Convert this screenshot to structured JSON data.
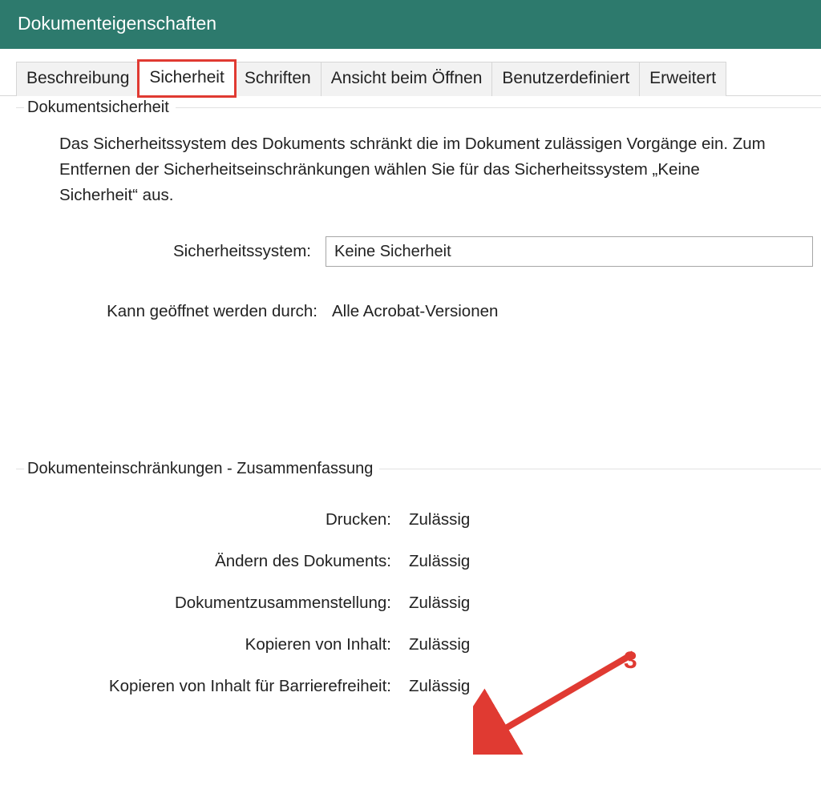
{
  "window": {
    "title": "Dokumenteigenschaften"
  },
  "tabs": [
    {
      "label": "Beschreibung"
    },
    {
      "label": "Sicherheit"
    },
    {
      "label": "Schriften"
    },
    {
      "label": "Ansicht beim Öffnen"
    },
    {
      "label": "Benutzerdefiniert"
    },
    {
      "label": "Erweitert"
    }
  ],
  "security": {
    "legend": "Dokumentsicherheit",
    "description": "Das Sicherheitssystem des Dokuments schränkt die im Dokument zulässigen Vorgänge ein. Zum Entfernen der Sicherheitseinschränkungen wählen Sie für das Sicherheitssystem „Keine Sicherheit“ aus.",
    "system_label": "Sicherheitssystem:",
    "system_value": "Keine Sicherheit",
    "openby_label": "Kann geöffnet werden durch:",
    "openby_value": "Alle Acrobat-Versionen"
  },
  "restrictions": {
    "legend": "Dokumenteinschränkungen - Zusammenfassung",
    "rows": [
      {
        "label": "Drucken:",
        "value": "Zulässig"
      },
      {
        "label": "Ändern des Dokuments:",
        "value": "Zulässig"
      },
      {
        "label": "Dokumentzusammenstellung:",
        "value": "Zulässig"
      },
      {
        "label": "Kopieren von Inhalt:",
        "value": "Zulässig"
      },
      {
        "label": "Kopieren von Inhalt für Barrierefreiheit:",
        "value": "Zulässig"
      }
    ]
  },
  "annotation": {
    "number": "3"
  }
}
